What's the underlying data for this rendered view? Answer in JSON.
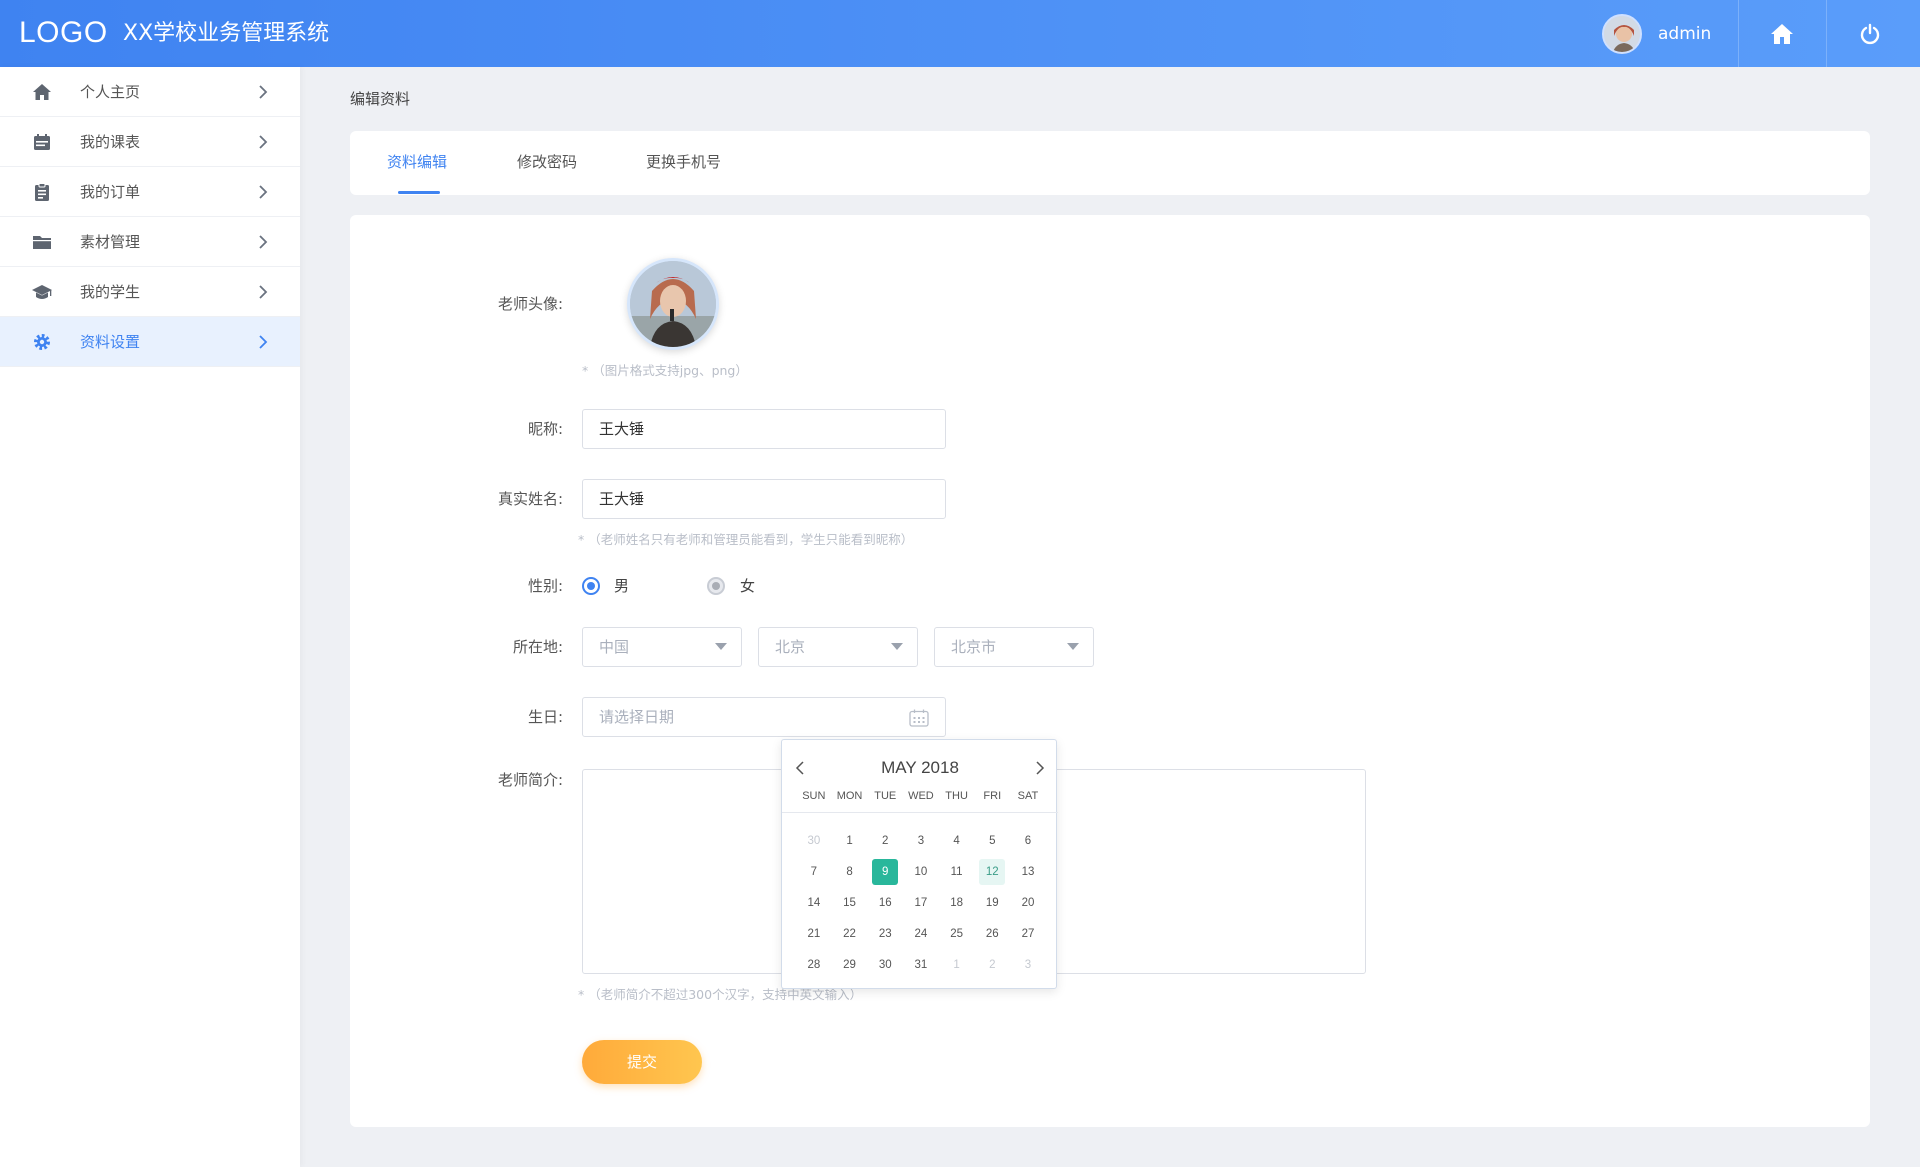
{
  "header": {
    "logo": "LOGO",
    "title": "XX学校业务管理系统",
    "user_name": "admin"
  },
  "sidebar": {
    "items": [
      {
        "label": "个人主页",
        "icon": "home-icon"
      },
      {
        "label": "我的课表",
        "icon": "calendar-icon"
      },
      {
        "label": "我的订单",
        "icon": "clipboard-icon"
      },
      {
        "label": "素材管理",
        "icon": "folder-icon"
      },
      {
        "label": "我的学生",
        "icon": "graduation-cap-icon"
      },
      {
        "label": "资料设置",
        "icon": "gear-icon",
        "active": true
      }
    ]
  },
  "breadcrumb": "编辑资料",
  "tabs": [
    {
      "label": "资料编辑",
      "active": true
    },
    {
      "label": "修改密码"
    },
    {
      "label": "更换手机号"
    }
  ],
  "form": {
    "avatar_label": "老师头像:",
    "avatar_hint": "* （图片格式支持jpg、png）",
    "nickname_label": "昵称:",
    "nickname_value": "王大锤",
    "realname_label": "真实姓名:",
    "realname_value": "王大锤",
    "realname_hint": "* （老师姓名只有老师和管理员能看到，学生只能看到昵称）",
    "gender_label": "性别:",
    "gender_male": "男",
    "gender_female": "女",
    "location_label": "所在地:",
    "country": "中国",
    "province": "北京",
    "city": "北京市",
    "birthday_label": "生日:",
    "birthday_placeholder": "请选择日期",
    "intro_label": "老师简介:",
    "intro_hint": "* （老师简介不超过300个汉字，支持中英文输入）",
    "submit": "提交"
  },
  "calendar": {
    "title": "MAY 2018",
    "weekdays": [
      "SUN",
      "MON",
      "TUE",
      "WED",
      "THU",
      "FRI",
      "SAT"
    ],
    "weeks": [
      [
        {
          "d": "30",
          "m": 1
        },
        {
          "d": "1"
        },
        {
          "d": "2"
        },
        {
          "d": "3"
        },
        {
          "d": "4"
        },
        {
          "d": "5"
        },
        {
          "d": "6"
        }
      ],
      [
        {
          "d": "7"
        },
        {
          "d": "8"
        },
        {
          "d": "9",
          "sel": 1
        },
        {
          "d": "10"
        },
        {
          "d": "11"
        },
        {
          "d": "12",
          "hl": 1
        },
        {
          "d": "13"
        }
      ],
      [
        {
          "d": "14"
        },
        {
          "d": "15"
        },
        {
          "d": "16"
        },
        {
          "d": "17"
        },
        {
          "d": "18"
        },
        {
          "d": "19"
        },
        {
          "d": "20"
        }
      ],
      [
        {
          "d": "21"
        },
        {
          "d": "22"
        },
        {
          "d": "23"
        },
        {
          "d": "24"
        },
        {
          "d": "25"
        },
        {
          "d": "26"
        },
        {
          "d": "27"
        }
      ],
      [
        {
          "d": "28"
        },
        {
          "d": "29"
        },
        {
          "d": "30"
        },
        {
          "d": "31"
        },
        {
          "d": "1",
          "m": 1
        },
        {
          "d": "2",
          "m": 1
        },
        {
          "d": "3",
          "m": 1
        }
      ]
    ]
  },
  "colors": {
    "primary": "#3f83f1",
    "selected_day": "#29b79b",
    "submit": "#ffb445"
  }
}
